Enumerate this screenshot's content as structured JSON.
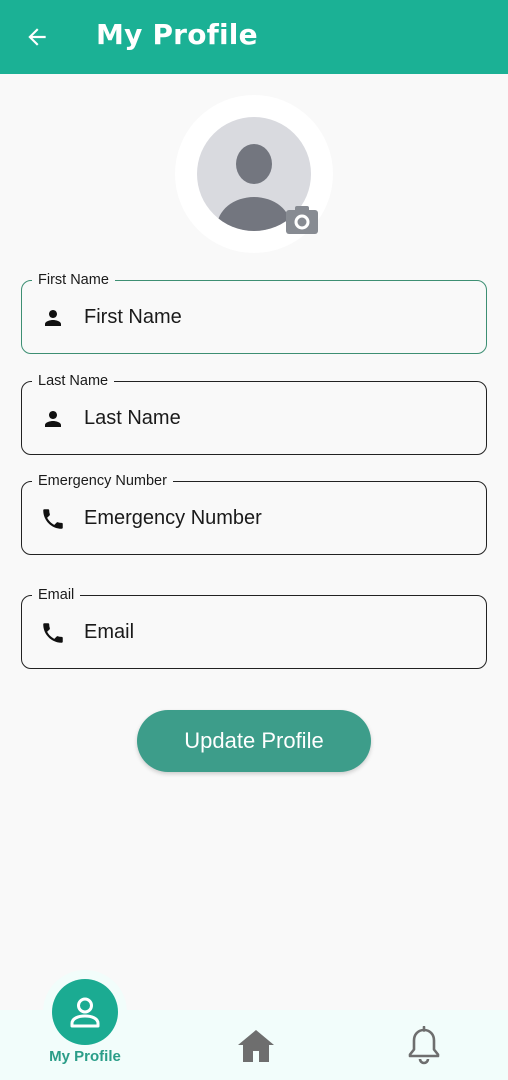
{
  "appbar": {
    "title": "My Profile",
    "back_icon": "arrow-left-icon",
    "color": "#1bb195"
  },
  "profile": {
    "avatar_icon": "person-placeholder-icon",
    "camera_icon": "camera-icon"
  },
  "fields": [
    {
      "label": "First Name",
      "placeholder": "First Name",
      "icon": "person-icon",
      "focused": true
    },
    {
      "label": "Last Name",
      "placeholder": "Last Name",
      "icon": "person-icon"
    },
    {
      "label": "Emergency Number",
      "placeholder": "Emergency Number",
      "icon": "phone-icon"
    },
    {
      "label": "Email",
      "placeholder": "Email",
      "icon": "phone-icon"
    }
  ],
  "update_button": {
    "label": "Update Profile",
    "color": "#3d9d8a"
  },
  "bottom_nav": {
    "items": [
      {
        "label": "My Profile",
        "icon": "person-outline-icon",
        "active": true
      },
      {
        "label": "",
        "icon": "home-icon"
      },
      {
        "label": "",
        "icon": "bell-icon"
      }
    ],
    "accent": "#1bab92"
  }
}
